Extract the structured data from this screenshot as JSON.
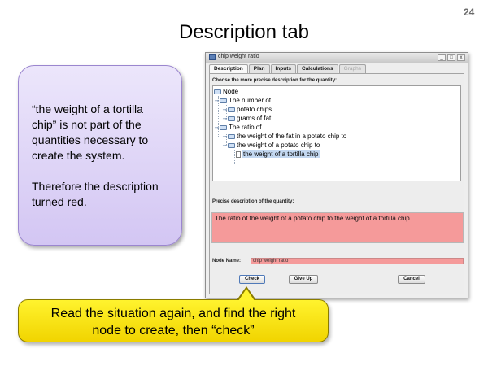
{
  "slide": {
    "page_number": "24",
    "title": "Description tab",
    "note_paragraphs": [
      "“the weight of a tortilla chip” is not part of the quantities necessary to create the system.",
      "Therefore the description turned red."
    ],
    "callout_line1": "Read the situation again, and find the right",
    "callout_line2": "node to create, then “check”"
  },
  "window": {
    "title": "chip weight ratio",
    "buttons": [
      "_",
      "□",
      "x"
    ],
    "tabs": [
      {
        "label": "Description",
        "state": "active"
      },
      {
        "label": "Plan",
        "state": "normal"
      },
      {
        "label": "Inputs",
        "state": "normal"
      },
      {
        "label": "Calculations",
        "state": "normal"
      },
      {
        "label": "Graphs",
        "state": "disabled"
      }
    ],
    "tree_prompt": "Choose the more precise description for the quantity:",
    "tree": {
      "root": "Node",
      "number_of": "The number of",
      "potato_chips": "potato chips",
      "grams_of_fat": "grams of fat",
      "ratio_of": "The ratio of",
      "fat_weight": "the weight of the fat in a potato chip to",
      "chip_weight": "the weight of a potato chip to",
      "tortilla_weight": "the weight of a tortilla chip",
      "selected": "the weight of a tortilla chip"
    },
    "description_label": "Precise description of the quantity:",
    "description_value": "The ratio of the weight of a potato chip to the weight of a tortilla chip",
    "node_name_label": "Node Name:",
    "node_name_value": "chip weight ratio",
    "check_label": "Check",
    "give_up_label": "Give Up",
    "cancel_label": "Cancel",
    "error_color": "#f59a9a",
    "selection_color": "#c3d8f1"
  },
  "colors": {
    "note_fill": "#d3c6f3",
    "callout_fill": "#fff32e"
  }
}
